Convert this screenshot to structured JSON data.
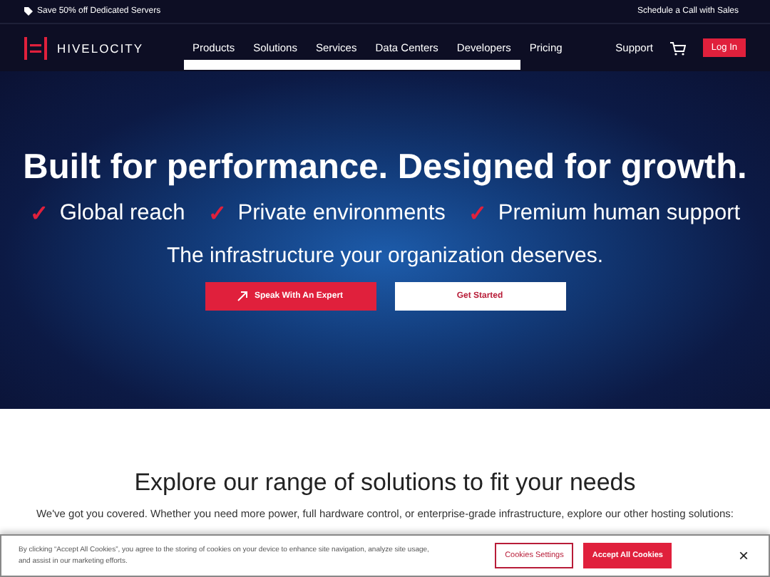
{
  "promo_bar": {
    "text": "Save 50% off Dedicated Servers",
    "link": "Schedule a Call with Sales"
  },
  "nav": {
    "brand": "HIVELOCITY",
    "items": [
      "Products",
      "Solutions",
      "Services",
      "Data Centers",
      "Developers",
      "Pricing"
    ],
    "support": "Support",
    "login": "Log In"
  },
  "hero": {
    "title": "Built for performance. Designed for growth.",
    "features": [
      {
        "mark": "✓",
        "text": "Global reach"
      },
      {
        "mark": "✓",
        "text": "Private environments"
      },
      {
        "mark": "✓",
        "text": "Premium human support"
      }
    ],
    "subtitle": "The infrastructure your organization deserves.",
    "buttons": [
      {
        "kind": "primary",
        "label": "Speak With An Expert"
      },
      {
        "kind": "secondary",
        "label": "Get Started"
      }
    ]
  },
  "solutions": {
    "title": "Explore our range of solutions to fit your needs",
    "text": "We've got you covered. Whether you need more power, full hardware control, or enterprise-grade infrastructure, explore our other hosting solutions:"
  },
  "cookie_banner": {
    "text": "By clicking “Accept All Cookies”, you agree to the storing of cookies on your device to enhance site navigation, analyze site usage, and assist in our marketing efforts.",
    "settings": "Cookies Settings",
    "accept": "Accept All Cookies",
    "close": "×"
  }
}
